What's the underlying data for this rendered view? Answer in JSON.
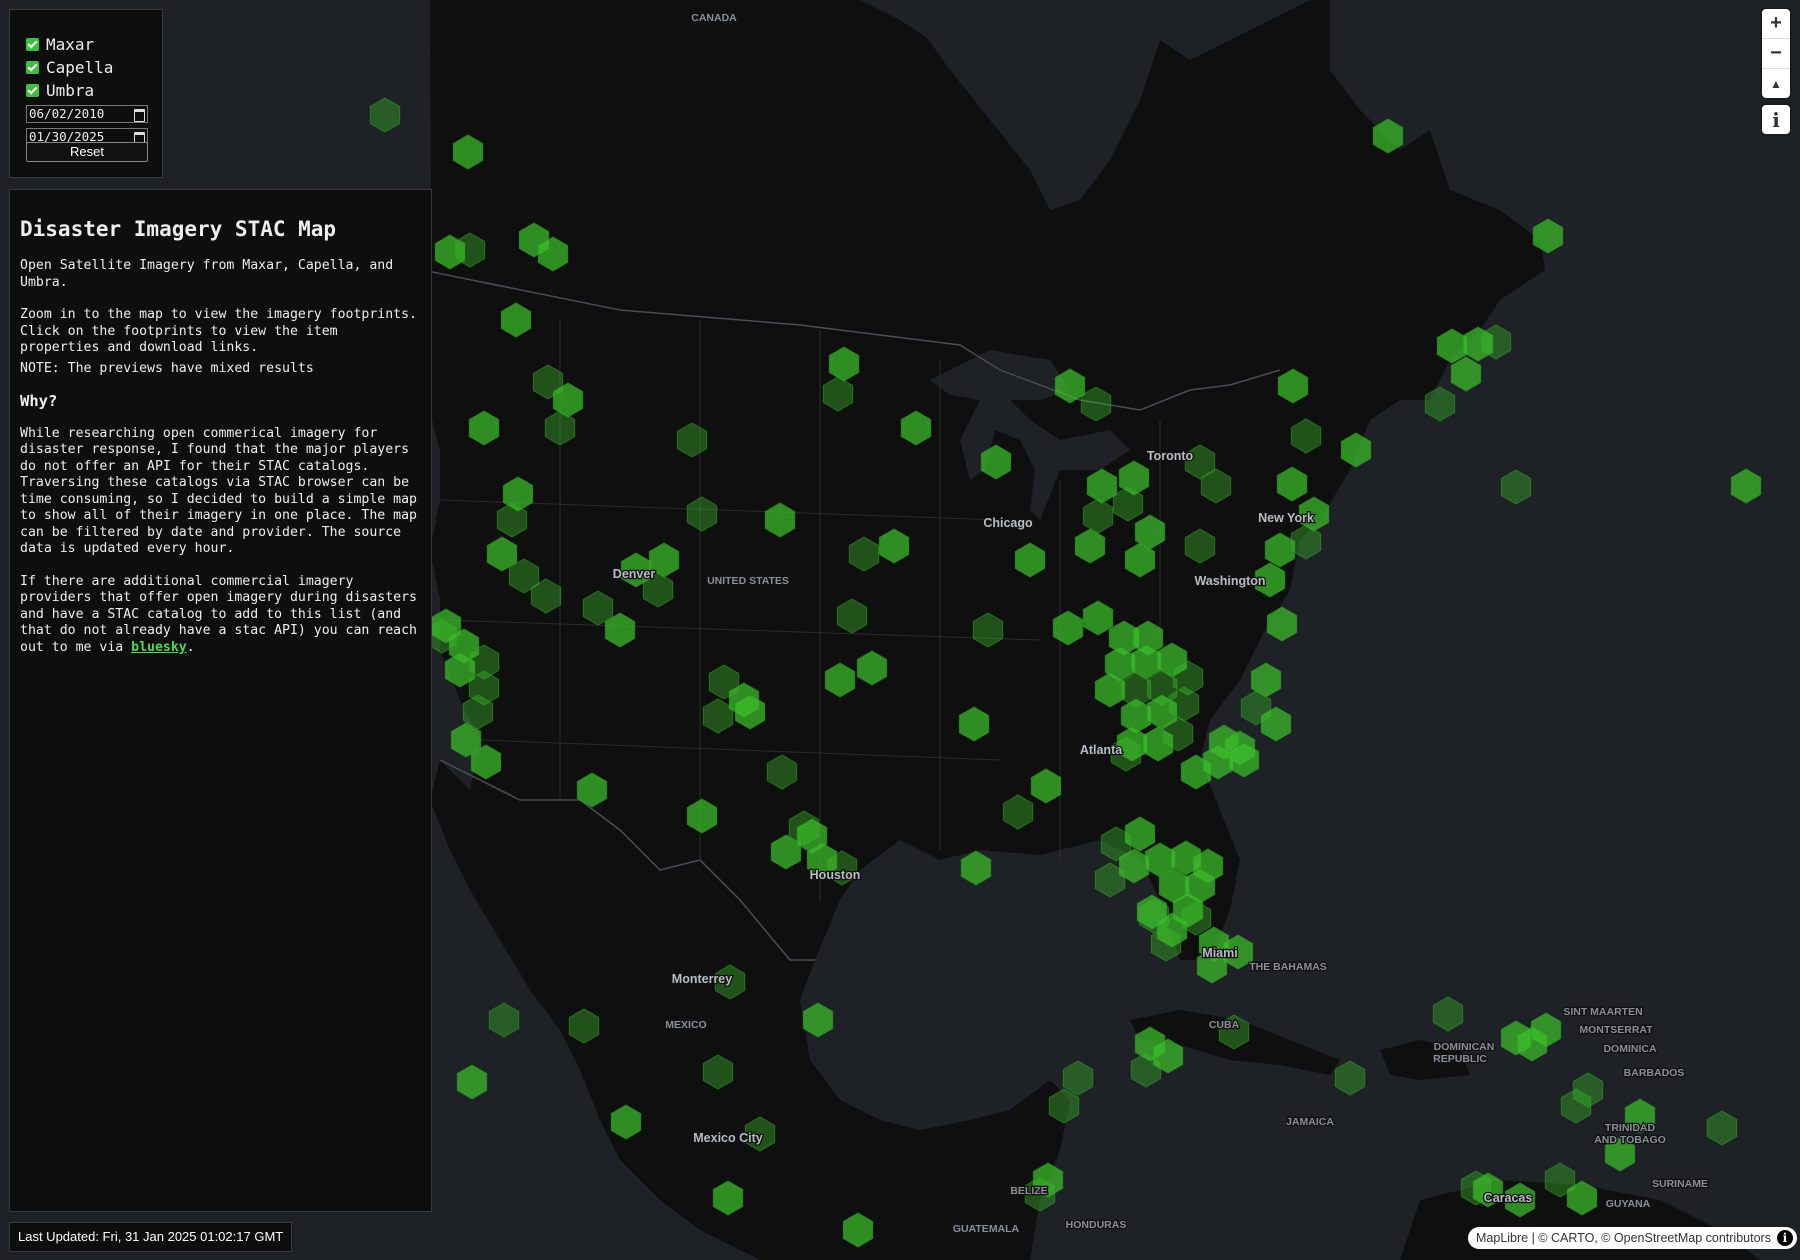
{
  "filters": {
    "providers": [
      {
        "label": "Maxar",
        "checked": true
      },
      {
        "label": "Capella",
        "checked": true
      },
      {
        "label": "Umbra",
        "checked": true
      }
    ],
    "start_date": "06/02/2010",
    "end_date": "01/30/2025",
    "reset_label": "Reset"
  },
  "info": {
    "title": "Disaster Imagery STAC Map",
    "subtitle": "Open Satellite Imagery from Maxar, Capella, and Umbra.",
    "instructions": "Zoom in to the map to view the imagery footprints. Click on the footprints to view the item properties and download links.",
    "note": "NOTE: The previews have mixed results",
    "why_heading": "Why?",
    "why_text": "While researching open commerical imagery for disaster response, I found that the major players do not offer an API for their STAC catalogs. Traversing these catalogs via STAC browser can be time consuming, so I decided to build a simple map to show all of their imagery in one place. The map can be filtered by date and provider. The source data is updated every hour.",
    "contact_prefix": "If there are additional commercial imagery providers that offer open imagery during disasters and have a STAC catalog to add to this list (and that do not already have a stac API) you can reach out to me via ",
    "contact_link": "bluesky",
    "contact_suffix": "."
  },
  "last_updated": "Last Updated: Fri, 31 Jan 2025 01:02:17 GMT",
  "map_controls": {
    "zoom_in": "+",
    "zoom_out": "−",
    "compass": "▲",
    "info": "i"
  },
  "attribution": {
    "text": "MapLibre | © CARTO, © OpenStreetMap contributors",
    "info_icon": "i"
  },
  "map_labels": [
    {
      "text": "CANADA",
      "kind": "country"
    },
    {
      "text": "UNITED STATES",
      "kind": "country"
    },
    {
      "text": "MEXICO",
      "kind": "country"
    },
    {
      "text": "CUBA",
      "kind": "country"
    },
    {
      "text": "THE BAHAMAS",
      "kind": "country"
    },
    {
      "text": "JAMAICA",
      "kind": "country"
    },
    {
      "text": "GUATEMALA",
      "kind": "country"
    },
    {
      "text": "HONDURAS",
      "kind": "country"
    },
    {
      "text": "BELIZE",
      "kind": "country"
    },
    {
      "text": "DOMINICAN",
      "kind": "country"
    },
    {
      "text": "REPUBLIC",
      "kind": "country"
    },
    {
      "text": "SINT MAARTEN",
      "kind": "country"
    },
    {
      "text": "MONTSERRAT",
      "kind": "country"
    },
    {
      "text": "DOMINICA",
      "kind": "country"
    },
    {
      "text": "BARBADOS",
      "kind": "country"
    },
    {
      "text": "TRINIDAD",
      "kind": "country"
    },
    {
      "text": "AND TOBAGO",
      "kind": "country"
    },
    {
      "text": "SURINAME",
      "kind": "country"
    },
    {
      "text": "GUYANA",
      "kind": "country"
    },
    {
      "text": "Toronto",
      "kind": "city"
    },
    {
      "text": "Chicago",
      "kind": "city"
    },
    {
      "text": "New York",
      "kind": "city"
    },
    {
      "text": "Washington",
      "kind": "city"
    },
    {
      "text": "Denver",
      "kind": "city"
    },
    {
      "text": "Atlanta",
      "kind": "city"
    },
    {
      "text": "Houston",
      "kind": "city"
    },
    {
      "text": "Miami",
      "kind": "city"
    },
    {
      "text": "Monterrey",
      "kind": "city"
    },
    {
      "text": "Mexico City",
      "kind": "city"
    },
    {
      "text": "Caracas",
      "kind": "city"
    }
  ],
  "colors": {
    "ocean": "#1e2126",
    "land": "#0f0f10",
    "footprint": "#3cbf2a",
    "panel_bg": "#0e0e0e",
    "checkbox": "#3fbf3f",
    "link": "#4cd94c"
  }
}
